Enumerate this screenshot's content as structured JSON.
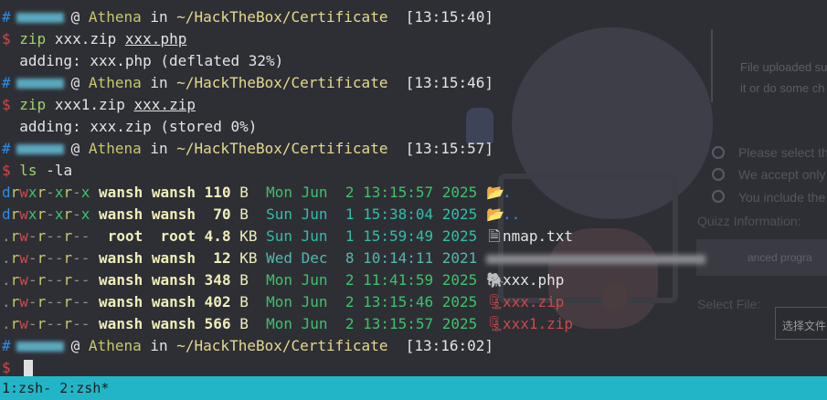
{
  "background_page": {
    "notice_line1": "File uploaded su",
    "notice_line2": "it or do some ch",
    "rules": [
      "Please select th",
      "We accept only",
      "You include the"
    ],
    "quiz_label": "Quizz Information:",
    "quiz_value": "anced progra",
    "select_file_label": "Select File:",
    "choose_file_button": "选择文件"
  },
  "prompt": {
    "hash": "#",
    "at": "@",
    "host": "Athena",
    "in": "in",
    "path": "~/HackTheBox/Certificate",
    "dollar": "$"
  },
  "blocks": [
    {
      "time": "[13:15:40]",
      "cmd": "zip",
      "args": "xxx.zip",
      "arg_ul": "xxx.php",
      "output": "  adding: xxx.php (deflated 32%)"
    },
    {
      "time": "[13:15:46]",
      "cmd": "zip",
      "args": "xxx1.zip",
      "arg_ul": "xxx.zip",
      "output": "  adding: xxx.zip (stored 0%)"
    },
    {
      "time": "[13:15:57]",
      "cmd": "ls",
      "args": "-la"
    }
  ],
  "ls_rows": [
    {
      "perm_type": "d",
      "perm": [
        "r",
        "w",
        "x",
        "r",
        "-",
        "x",
        "r",
        "-",
        "x"
      ],
      "user": "wansh",
      "group": "wansh",
      "size": "110",
      "unit": "B",
      "date": "Mon Jun  2 13:15:57 2025",
      "date_style": "new",
      "icon": "folder-open-icon",
      "name": "."
    },
    {
      "perm_type": "d",
      "perm": [
        "r",
        "w",
        "x",
        "r",
        "-",
        "x",
        "r",
        "-",
        "x"
      ],
      "user": "wansh",
      "group": "wansh",
      "size": " 70",
      "unit": "B",
      "date": "Sun Jun  1 15:38:04 2025",
      "date_style": "mid",
      "icon": "folder-open-icon",
      "name": ".."
    },
    {
      "perm_type": ".",
      "perm": [
        "r",
        "w",
        "-",
        "r",
        "-",
        "-",
        "r",
        "-",
        "-"
      ],
      "user": "root",
      "group": "root",
      "size": "4.8",
      "unit": "KB",
      "date": "Sun Jun  1 15:59:49 2025",
      "date_style": "mid",
      "icon": "text-file-icon",
      "name": "nmap.txt"
    },
    {
      "perm_type": ".",
      "perm": [
        "r",
        "w",
        "-",
        "r",
        "-",
        "-",
        "r",
        "-",
        "-"
      ],
      "user": "wansh",
      "group": "wansh",
      "size": " 12",
      "unit": "KB",
      "date": "Wed Dec  8 10:14:11 2021",
      "date_style": "old",
      "icon": "",
      "name": ""
    },
    {
      "perm_type": ".",
      "perm": [
        "r",
        "w",
        "-",
        "r",
        "-",
        "-",
        "r",
        "-",
        "-"
      ],
      "user": "wansh",
      "group": "wansh",
      "size": "348",
      "unit": "B",
      "date": "Mon Jun  2 11:41:59 2025",
      "date_style": "new",
      "icon": "php-elephant-icon",
      "name": "xxx.php"
    },
    {
      "perm_type": ".",
      "perm": [
        "r",
        "w",
        "-",
        "r",
        "-",
        "-",
        "r",
        "-",
        "-"
      ],
      "user": "wansh",
      "group": "wansh",
      "size": "402",
      "unit": "B",
      "date": "Mon Jun  2 13:15:46 2025",
      "date_style": "new",
      "icon": "zip-archive-icon",
      "name": "xxx.zip"
    },
    {
      "perm_type": ".",
      "perm": [
        "r",
        "w",
        "-",
        "r",
        "-",
        "-",
        "r",
        "-",
        "-"
      ],
      "user": "wansh",
      "group": "wansh",
      "size": "566",
      "unit": "B",
      "date": "Mon Jun  2 13:15:57 2025",
      "date_style": "new",
      "icon": "zip-archive-icon",
      "name": "xxx1.zip"
    }
  ],
  "final_prompt": {
    "time": "[13:16:02]"
  },
  "statusbar": {
    "text": "1:zsh- 2:zsh*"
  },
  "colors": {
    "accent_statusbar": "#22b5c8",
    "dir_blue": "#2d8ce6",
    "prompt_red": "#d04848",
    "cmd_green": "#9ed16a"
  }
}
